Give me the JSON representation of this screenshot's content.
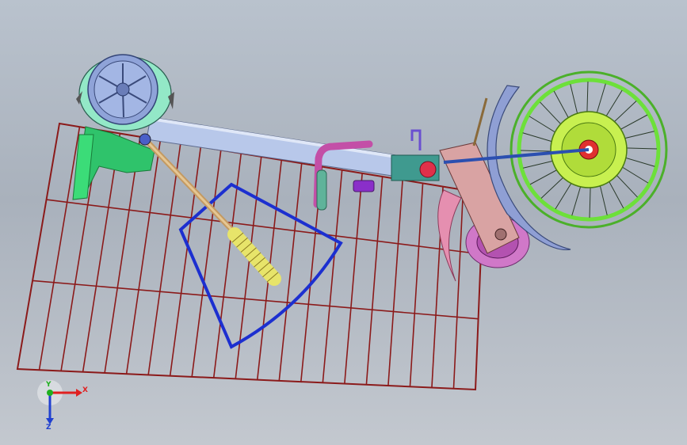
{
  "viewport": {
    "background_top": "#b9c2cd",
    "background_bottom": "#c3c8cf"
  },
  "model": {
    "parts": [
      "wire-grid-frame",
      "rear-wheel-assembly",
      "main-beam",
      "handle-tube",
      "blade-outline",
      "yellow-handle",
      "front-wheel",
      "front-fender",
      "brake-disc",
      "pedal-crank"
    ],
    "colors": {
      "grid": "#8b1a1a",
      "beam": "#b8c8ea",
      "blade": "#1c2fd0",
      "handle": "#e7e46a",
      "front_wheel": "#6de03a",
      "brake_disc": "#c8f050",
      "fender": "#8f9fd4",
      "crank": "#e58fb0",
      "rear_hub": "#9aa9d8"
    }
  },
  "triad": {
    "x_label": "X",
    "y_label": "Y",
    "z_label": "Z",
    "x_color": "#e02020",
    "y_color": "#20b020",
    "z_color": "#2040d0"
  }
}
